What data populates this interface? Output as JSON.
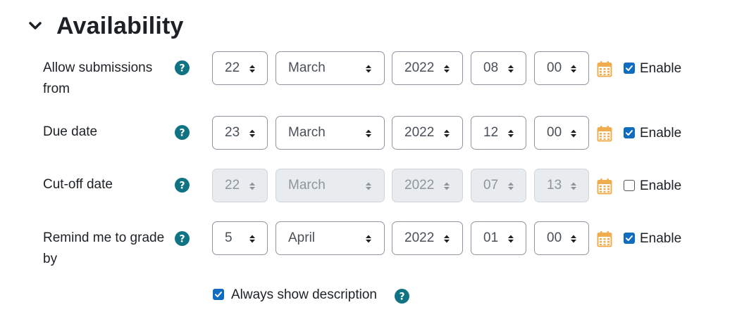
{
  "section": {
    "title": "Availability",
    "icon": "chevron-down-icon"
  },
  "rows": [
    {
      "label": "Allow submissions from",
      "day": "22",
      "month": "March",
      "year": "2022",
      "hour": "08",
      "minute": "00",
      "enable_label": "Enable",
      "enabled": true,
      "disabled": false
    },
    {
      "label": "Due date",
      "day": "23",
      "month": "March",
      "year": "2022",
      "hour": "12",
      "minute": "00",
      "enable_label": "Enable",
      "enabled": true,
      "disabled": false
    },
    {
      "label": "Cut-off date",
      "day": "22",
      "month": "March",
      "year": "2022",
      "hour": "07",
      "minute": "13",
      "enable_label": "Enable",
      "enabled": false,
      "disabled": true
    },
    {
      "label": "Remind me to grade by",
      "day": "5",
      "month": "April",
      "year": "2022",
      "hour": "01",
      "minute": "00",
      "enable_label": "Enable",
      "enabled": true,
      "disabled": false
    }
  ],
  "always_show": {
    "label": "Always show description",
    "checked": true
  },
  "colors": {
    "help": "#0f7384",
    "calendar": "#f0ad4e",
    "checkbox": "#0f6cbf",
    "text": "#1d2125"
  }
}
